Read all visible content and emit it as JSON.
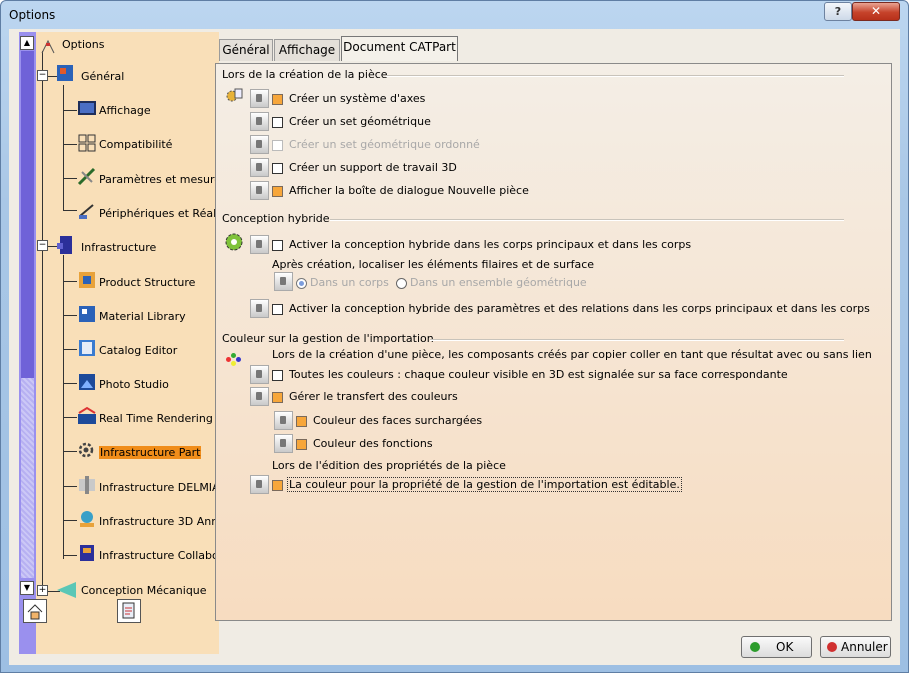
{
  "window": {
    "title": "Options",
    "help_label": "?",
    "close_label": "✕"
  },
  "tree": {
    "root": "Options",
    "items": [
      {
        "label": "Général",
        "icon": "general-icon"
      },
      {
        "label": "Affichage",
        "icon": "display-icon"
      },
      {
        "label": "Compatibilité",
        "icon": "compatibility-icon"
      },
      {
        "label": "Paramètres et mesure",
        "icon": "parameters-icon"
      },
      {
        "label": "Périphériques et Réali",
        "icon": "devices-icon"
      },
      {
        "label": "Infrastructure",
        "icon": "infrastructure-icon"
      },
      {
        "label": "Product Structure",
        "icon": "product-structure-icon"
      },
      {
        "label": "Material Library",
        "icon": "material-library-icon"
      },
      {
        "label": "Catalog Editor",
        "icon": "catalog-editor-icon"
      },
      {
        "label": "Photo Studio",
        "icon": "photo-studio-icon"
      },
      {
        "label": "Real Time Rendering",
        "icon": "rendering-icon"
      },
      {
        "label": "Infrastructure Part",
        "icon": "gear-icon"
      },
      {
        "label": "Infrastructure DELMIA",
        "icon": "delmia-icon"
      },
      {
        "label": "Infrastructure 3D Ann",
        "icon": "annotation-icon"
      },
      {
        "label": "Infrastructure Collabo",
        "icon": "collaboration-icon"
      },
      {
        "label": "Conception Mécanique",
        "icon": "mechanical-icon"
      }
    ],
    "selected": "Infrastructure Part"
  },
  "tabs": [
    "Général",
    "Affichage",
    "Document CATPart"
  ],
  "active_tab": "Document CATPart",
  "sections": {
    "creation": {
      "title": "Lors de la création de la pièce",
      "options": [
        {
          "label": "Créer un système d'axes",
          "checked": true,
          "disabled": false
        },
        {
          "label": "Créer un set géométrique",
          "checked": false,
          "disabled": false
        },
        {
          "label": "Créer un set géométrique ordonné",
          "checked": false,
          "disabled": true
        },
        {
          "label": "Créer un support de travail 3D",
          "checked": false,
          "disabled": false
        },
        {
          "label": "Afficher la boîte de dialogue Nouvelle pièce",
          "checked": true,
          "disabled": false
        }
      ]
    },
    "hybrid": {
      "title": "Conception hybride",
      "option1": "Activer la conception hybride dans les corps principaux et dans les corps",
      "sublabel": "Après création, localiser les éléments filaires et de surface",
      "radio1": "Dans un corps",
      "radio2": "Dans un ensemble géométrique",
      "option2": "Activer la conception hybride des paramètres et des relations dans les corps principaux et dans les corps"
    },
    "color": {
      "title": "Couleur sur la gestion de l'importation",
      "intro": "Lors de la création d'une pièce, les composants créés par copier coller en tant que résultat avec ou sans lien",
      "opt_all": "Toutes les couleurs : chaque couleur visible en 3D est signalée sur sa face correspondante",
      "opt_manage": "Gérer le transfert des couleurs",
      "opt_faces": "Couleur des faces surchargées",
      "opt_features": "Couleur des fonctions",
      "edit_label": "Lors de l'édition des propriétés de la pièce",
      "opt_editable": "La couleur pour la propriété de la gestion de l'importation est éditable."
    }
  },
  "buttons": {
    "ok": "OK",
    "cancel": "Annuler"
  }
}
